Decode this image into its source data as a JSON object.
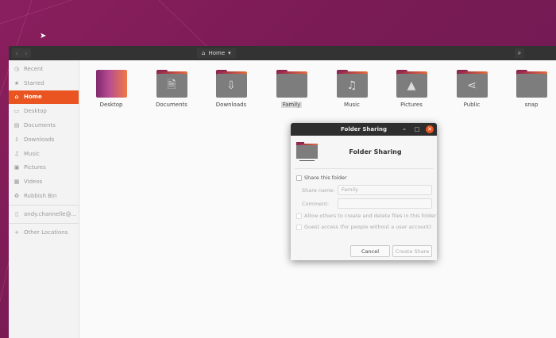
{
  "headerbar": {
    "path_label": "Home",
    "path_icon": "home-icon",
    "back_icon": "chevron-left-icon",
    "forward_icon": "chevron-right-icon",
    "search_icon": "search-icon"
  },
  "sidebar": {
    "items": [
      {
        "label": "Recent",
        "icon": "clock-icon"
      },
      {
        "label": "Starred",
        "icon": "star-icon"
      },
      {
        "label": "Home",
        "icon": "home-icon",
        "active": true
      },
      {
        "label": "Desktop",
        "icon": "desktop-icon"
      },
      {
        "label": "Documents",
        "icon": "document-icon"
      },
      {
        "label": "Downloads",
        "icon": "download-icon"
      },
      {
        "label": "Music",
        "icon": "music-icon"
      },
      {
        "label": "Pictures",
        "icon": "picture-icon"
      },
      {
        "label": "Videos",
        "icon": "video-icon"
      },
      {
        "label": "Rubbish Bin",
        "icon": "trash-icon"
      },
      {
        "label": "andy.channelle@...",
        "icon": "drive-icon"
      },
      {
        "label": "Other Locations",
        "icon": "plus-icon"
      }
    ]
  },
  "folders": [
    {
      "label": "Desktop",
      "icon": ""
    },
    {
      "label": "Documents",
      "icon": "document-icon"
    },
    {
      "label": "Downloads",
      "icon": "download-icon"
    },
    {
      "label": "Family",
      "icon": "",
      "selected": true
    },
    {
      "label": "Music",
      "icon": "music-icon"
    },
    {
      "label": "Pictures",
      "icon": "picture-icon"
    },
    {
      "label": "Public",
      "icon": "share-icon"
    },
    {
      "label": "snap",
      "icon": ""
    }
  ],
  "dialog": {
    "title": "Folder Sharing",
    "heading": "Folder Sharing",
    "share_label": "Share this folder",
    "share_name_label": "Share name:",
    "share_name_value": "Family",
    "comment_label": "Comment:",
    "comment_value": "",
    "allow_label": "Allow others to create and delete files in this folder",
    "guest_label": "Guest access (for people without a user account)",
    "cancel": "Cancel",
    "create": "Create Share"
  },
  "colors": {
    "accent": "#e95420",
    "headerbar": "#333333",
    "folder": "#7d7d7d"
  }
}
